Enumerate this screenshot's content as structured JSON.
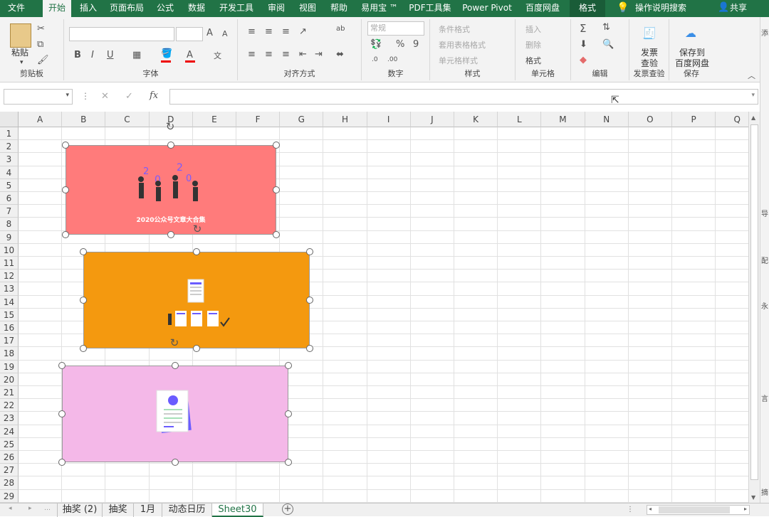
{
  "tabs": [
    "文件",
    "开始",
    "插入",
    "页面布局",
    "公式",
    "数据",
    "开发工具",
    "审阅",
    "视图",
    "帮助",
    "易用宝 ™",
    "PDF工具集",
    "Power Pivot",
    "百度网盘",
    "格式",
    "操作说明搜索",
    "共享"
  ],
  "ribbon": {
    "clipboard": {
      "paste": "粘贴",
      "label": "剪贴板"
    },
    "font": {
      "label": "字体",
      "bold": "B",
      "italic": "I",
      "underline": "U",
      "grow": "A",
      "shrink": "A",
      "font_color": "A"
    },
    "align": {
      "label": "对齐方式",
      "wrap": "ab"
    },
    "number": {
      "format": "常规",
      "percent": "%",
      "comma": "9",
      "label": "数字"
    },
    "styles": {
      "cond": "条件格式",
      "table": "套用表格格式",
      "cell": "单元格样式",
      "label": "样式"
    },
    "cells": {
      "insert": "插入",
      "delete": "删除",
      "format": "格式",
      "label": "单元格"
    },
    "edit": {
      "label": "编辑"
    },
    "invoice": {
      "btn1": "发票",
      "btn2": "查验",
      "label": "发票查验"
    },
    "save": {
      "btn1": "保存到",
      "btn2": "百度网盘",
      "label": "保存"
    }
  },
  "formula_bar": {
    "name_box": "",
    "fx": "fx",
    "cancel": "✕",
    "enter": "✓",
    "formula": ""
  },
  "columns": [
    "A",
    "B",
    "C",
    "D",
    "E",
    "F",
    "G",
    "H",
    "I",
    "J",
    "K",
    "L",
    "M",
    "N",
    "O",
    "P",
    "Q"
  ],
  "rows": [
    "1",
    "2",
    "3",
    "4",
    "5",
    "6",
    "7",
    "8",
    "9",
    "10",
    "11",
    "12",
    "13",
    "14",
    "15",
    "16",
    "17",
    "18",
    "19",
    "20",
    "21",
    "22",
    "23",
    "24",
    "25",
    "26",
    "27",
    "28",
    "29"
  ],
  "cards": [
    {
      "caption": "2020公众号文章大合集",
      "color": "#ff7b7b"
    },
    {
      "caption": "",
      "color": "#f4990f"
    },
    {
      "caption": "",
      "color": "#f4b8e8"
    }
  ],
  "sheets": [
    "抽奖 (2)",
    "抽奖",
    "1月",
    "动态日历",
    "Sheet30"
  ],
  "add_sheet": "+",
  "right_pane_chars": [
    "添",
    "导",
    "配",
    "永",
    "言",
    "摘"
  ],
  "colors": {
    "excel_green": "#217346"
  }
}
